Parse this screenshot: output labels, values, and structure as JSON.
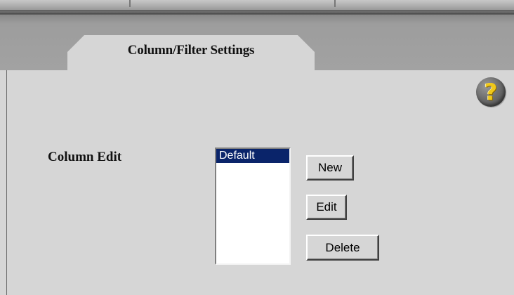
{
  "tab": {
    "title": "Column/Filter Settings"
  },
  "help": {
    "icon": "help-icon",
    "glyph": "?",
    "color": "#f0c81a"
  },
  "column_edit": {
    "label": "Column Edit",
    "list": {
      "items": [
        "Default"
      ],
      "selected_index": 0
    },
    "buttons": {
      "new": "New",
      "edit": "Edit",
      "delete": "Delete"
    }
  },
  "colors": {
    "panel_background": "#d6d6d6",
    "selection": "#0a246a"
  }
}
